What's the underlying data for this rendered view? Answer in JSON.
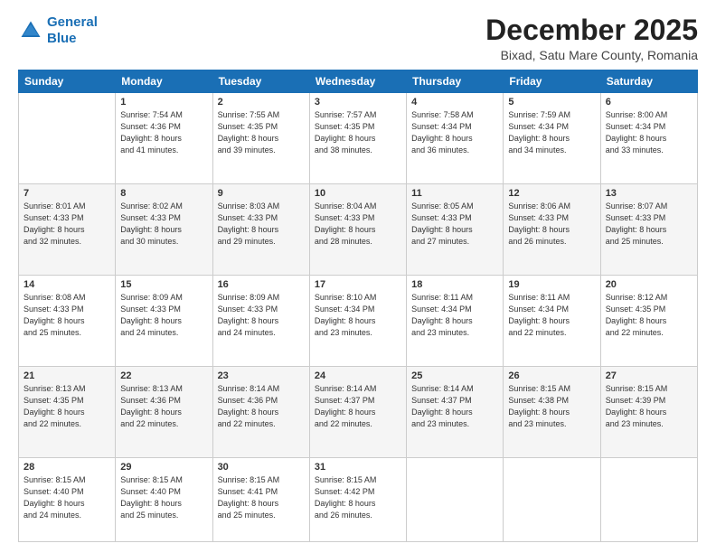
{
  "header": {
    "logo_line1": "General",
    "logo_line2": "Blue",
    "title": "December 2025",
    "subtitle": "Bixad, Satu Mare County, Romania"
  },
  "days_of_week": [
    "Sunday",
    "Monday",
    "Tuesday",
    "Wednesday",
    "Thursday",
    "Friday",
    "Saturday"
  ],
  "weeks": [
    [
      {
        "day": "",
        "info": ""
      },
      {
        "day": "1",
        "info": "Sunrise: 7:54 AM\nSunset: 4:36 PM\nDaylight: 8 hours\nand 41 minutes."
      },
      {
        "day": "2",
        "info": "Sunrise: 7:55 AM\nSunset: 4:35 PM\nDaylight: 8 hours\nand 39 minutes."
      },
      {
        "day": "3",
        "info": "Sunrise: 7:57 AM\nSunset: 4:35 PM\nDaylight: 8 hours\nand 38 minutes."
      },
      {
        "day": "4",
        "info": "Sunrise: 7:58 AM\nSunset: 4:34 PM\nDaylight: 8 hours\nand 36 minutes."
      },
      {
        "day": "5",
        "info": "Sunrise: 7:59 AM\nSunset: 4:34 PM\nDaylight: 8 hours\nand 34 minutes."
      },
      {
        "day": "6",
        "info": "Sunrise: 8:00 AM\nSunset: 4:34 PM\nDaylight: 8 hours\nand 33 minutes."
      }
    ],
    [
      {
        "day": "7",
        "info": "Sunrise: 8:01 AM\nSunset: 4:33 PM\nDaylight: 8 hours\nand 32 minutes."
      },
      {
        "day": "8",
        "info": "Sunrise: 8:02 AM\nSunset: 4:33 PM\nDaylight: 8 hours\nand 30 minutes."
      },
      {
        "day": "9",
        "info": "Sunrise: 8:03 AM\nSunset: 4:33 PM\nDaylight: 8 hours\nand 29 minutes."
      },
      {
        "day": "10",
        "info": "Sunrise: 8:04 AM\nSunset: 4:33 PM\nDaylight: 8 hours\nand 28 minutes."
      },
      {
        "day": "11",
        "info": "Sunrise: 8:05 AM\nSunset: 4:33 PM\nDaylight: 8 hours\nand 27 minutes."
      },
      {
        "day": "12",
        "info": "Sunrise: 8:06 AM\nSunset: 4:33 PM\nDaylight: 8 hours\nand 26 minutes."
      },
      {
        "day": "13",
        "info": "Sunrise: 8:07 AM\nSunset: 4:33 PM\nDaylight: 8 hours\nand 25 minutes."
      }
    ],
    [
      {
        "day": "14",
        "info": "Sunrise: 8:08 AM\nSunset: 4:33 PM\nDaylight: 8 hours\nand 25 minutes."
      },
      {
        "day": "15",
        "info": "Sunrise: 8:09 AM\nSunset: 4:33 PM\nDaylight: 8 hours\nand 24 minutes."
      },
      {
        "day": "16",
        "info": "Sunrise: 8:09 AM\nSunset: 4:33 PM\nDaylight: 8 hours\nand 24 minutes."
      },
      {
        "day": "17",
        "info": "Sunrise: 8:10 AM\nSunset: 4:34 PM\nDaylight: 8 hours\nand 23 minutes."
      },
      {
        "day": "18",
        "info": "Sunrise: 8:11 AM\nSunset: 4:34 PM\nDaylight: 8 hours\nand 23 minutes."
      },
      {
        "day": "19",
        "info": "Sunrise: 8:11 AM\nSunset: 4:34 PM\nDaylight: 8 hours\nand 22 minutes."
      },
      {
        "day": "20",
        "info": "Sunrise: 8:12 AM\nSunset: 4:35 PM\nDaylight: 8 hours\nand 22 minutes."
      }
    ],
    [
      {
        "day": "21",
        "info": "Sunrise: 8:13 AM\nSunset: 4:35 PM\nDaylight: 8 hours\nand 22 minutes."
      },
      {
        "day": "22",
        "info": "Sunrise: 8:13 AM\nSunset: 4:36 PM\nDaylight: 8 hours\nand 22 minutes."
      },
      {
        "day": "23",
        "info": "Sunrise: 8:14 AM\nSunset: 4:36 PM\nDaylight: 8 hours\nand 22 minutes."
      },
      {
        "day": "24",
        "info": "Sunrise: 8:14 AM\nSunset: 4:37 PM\nDaylight: 8 hours\nand 22 minutes."
      },
      {
        "day": "25",
        "info": "Sunrise: 8:14 AM\nSunset: 4:37 PM\nDaylight: 8 hours\nand 23 minutes."
      },
      {
        "day": "26",
        "info": "Sunrise: 8:15 AM\nSunset: 4:38 PM\nDaylight: 8 hours\nand 23 minutes."
      },
      {
        "day": "27",
        "info": "Sunrise: 8:15 AM\nSunset: 4:39 PM\nDaylight: 8 hours\nand 23 minutes."
      }
    ],
    [
      {
        "day": "28",
        "info": "Sunrise: 8:15 AM\nSunset: 4:40 PM\nDaylight: 8 hours\nand 24 minutes."
      },
      {
        "day": "29",
        "info": "Sunrise: 8:15 AM\nSunset: 4:40 PM\nDaylight: 8 hours\nand 25 minutes."
      },
      {
        "day": "30",
        "info": "Sunrise: 8:15 AM\nSunset: 4:41 PM\nDaylight: 8 hours\nand 25 minutes."
      },
      {
        "day": "31",
        "info": "Sunrise: 8:15 AM\nSunset: 4:42 PM\nDaylight: 8 hours\nand 26 minutes."
      },
      {
        "day": "",
        "info": ""
      },
      {
        "day": "",
        "info": ""
      },
      {
        "day": "",
        "info": ""
      }
    ]
  ]
}
